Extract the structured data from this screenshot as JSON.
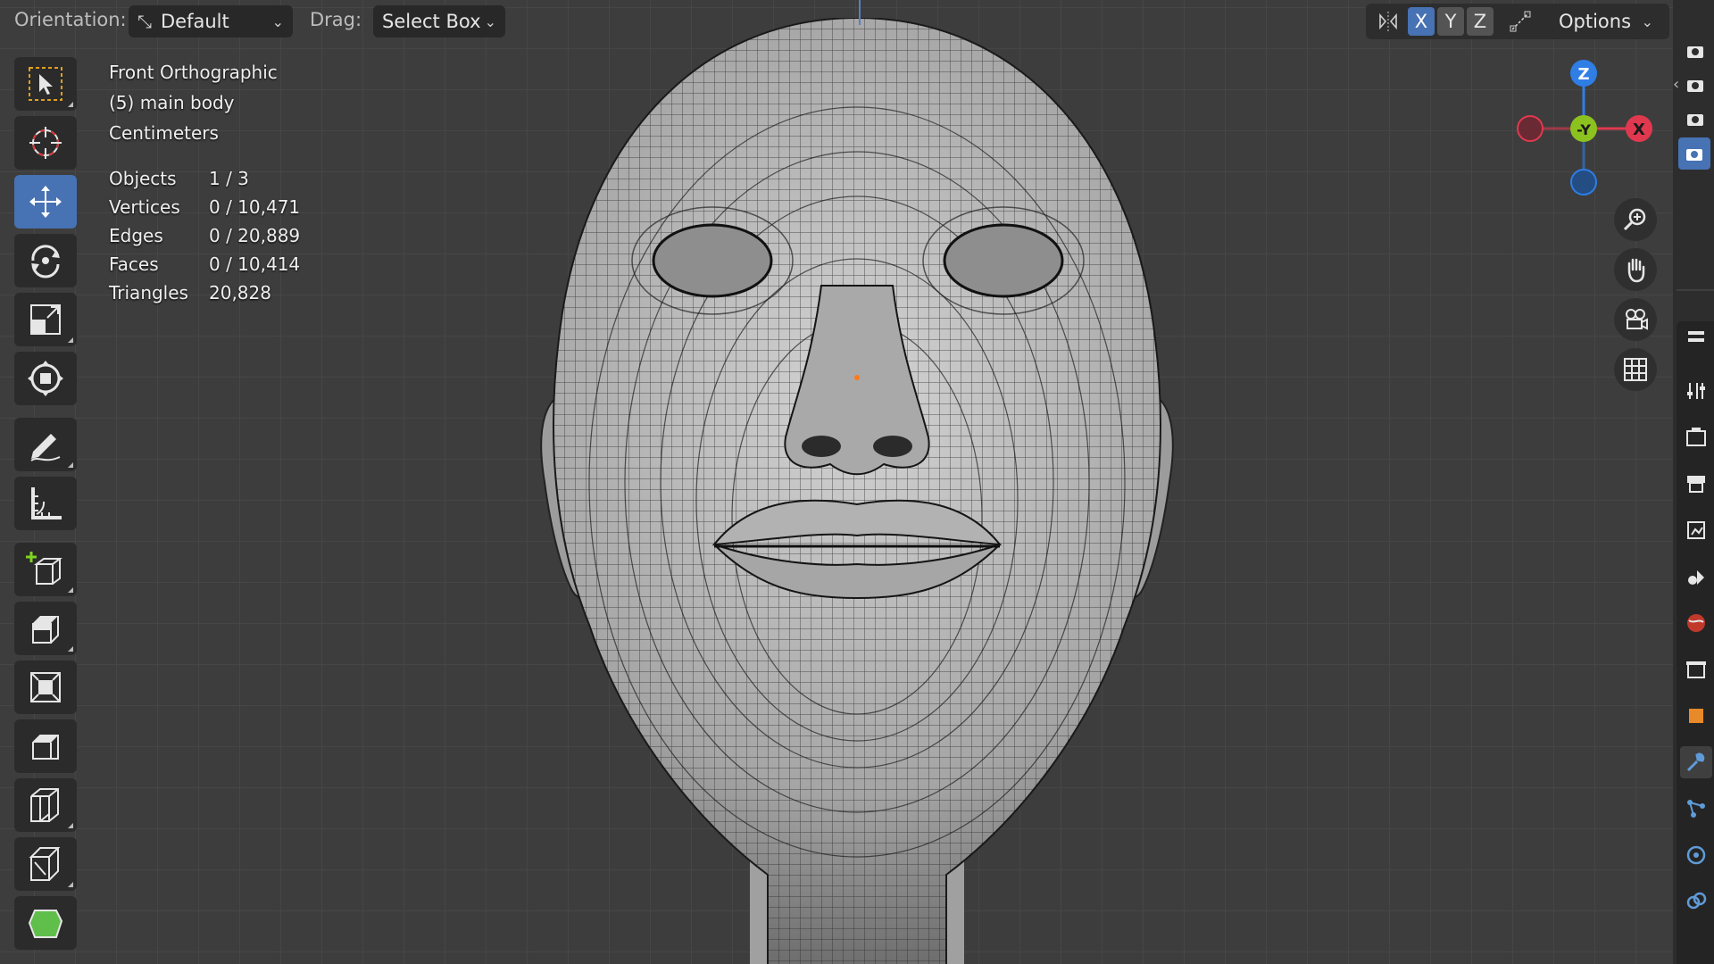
{
  "header": {
    "orientation_label": "Orientation:",
    "orientation_value": "Default",
    "drag_label": "Drag:",
    "drag_value": "Select Box",
    "axes": [
      "X",
      "Y",
      "Z"
    ],
    "options_label": "Options"
  },
  "overlay": {
    "view_name": "Front Orthographic",
    "object_name": "(5) main body",
    "units": "Centimeters",
    "stats": [
      {
        "label": "Objects",
        "value": "1 / 3"
      },
      {
        "label": "Vertices",
        "value": "0 / 10,471"
      },
      {
        "label": "Edges",
        "value": "0 / 20,889"
      },
      {
        "label": "Faces",
        "value": "0 / 10,414"
      },
      {
        "label": "Triangles",
        "value": "20,828"
      }
    ]
  },
  "gizmo": {
    "z_label": "Z",
    "y_label": "-Y",
    "x_label": "X",
    "colors": {
      "x": "#e0394f",
      "y": "#8cc21f",
      "z": "#2f7ee6"
    }
  },
  "toolbar": {
    "tools": [
      "select-box-tool",
      "cursor-tool",
      "move-tool",
      "rotate-tool",
      "scale-tool",
      "transform-tool",
      "annotate-tool",
      "measure-tool",
      "add-cube-tool",
      "extrude-tool",
      "inset-tool",
      "bevel-tool",
      "loop-cut-tool",
      "knife-tool",
      "poly-build-tool"
    ],
    "active_tool": "move-tool"
  },
  "colors": {
    "accent": "#4772b3",
    "viewport_bg": "#3d3d3d",
    "mesh": "#b8b8b8"
  }
}
